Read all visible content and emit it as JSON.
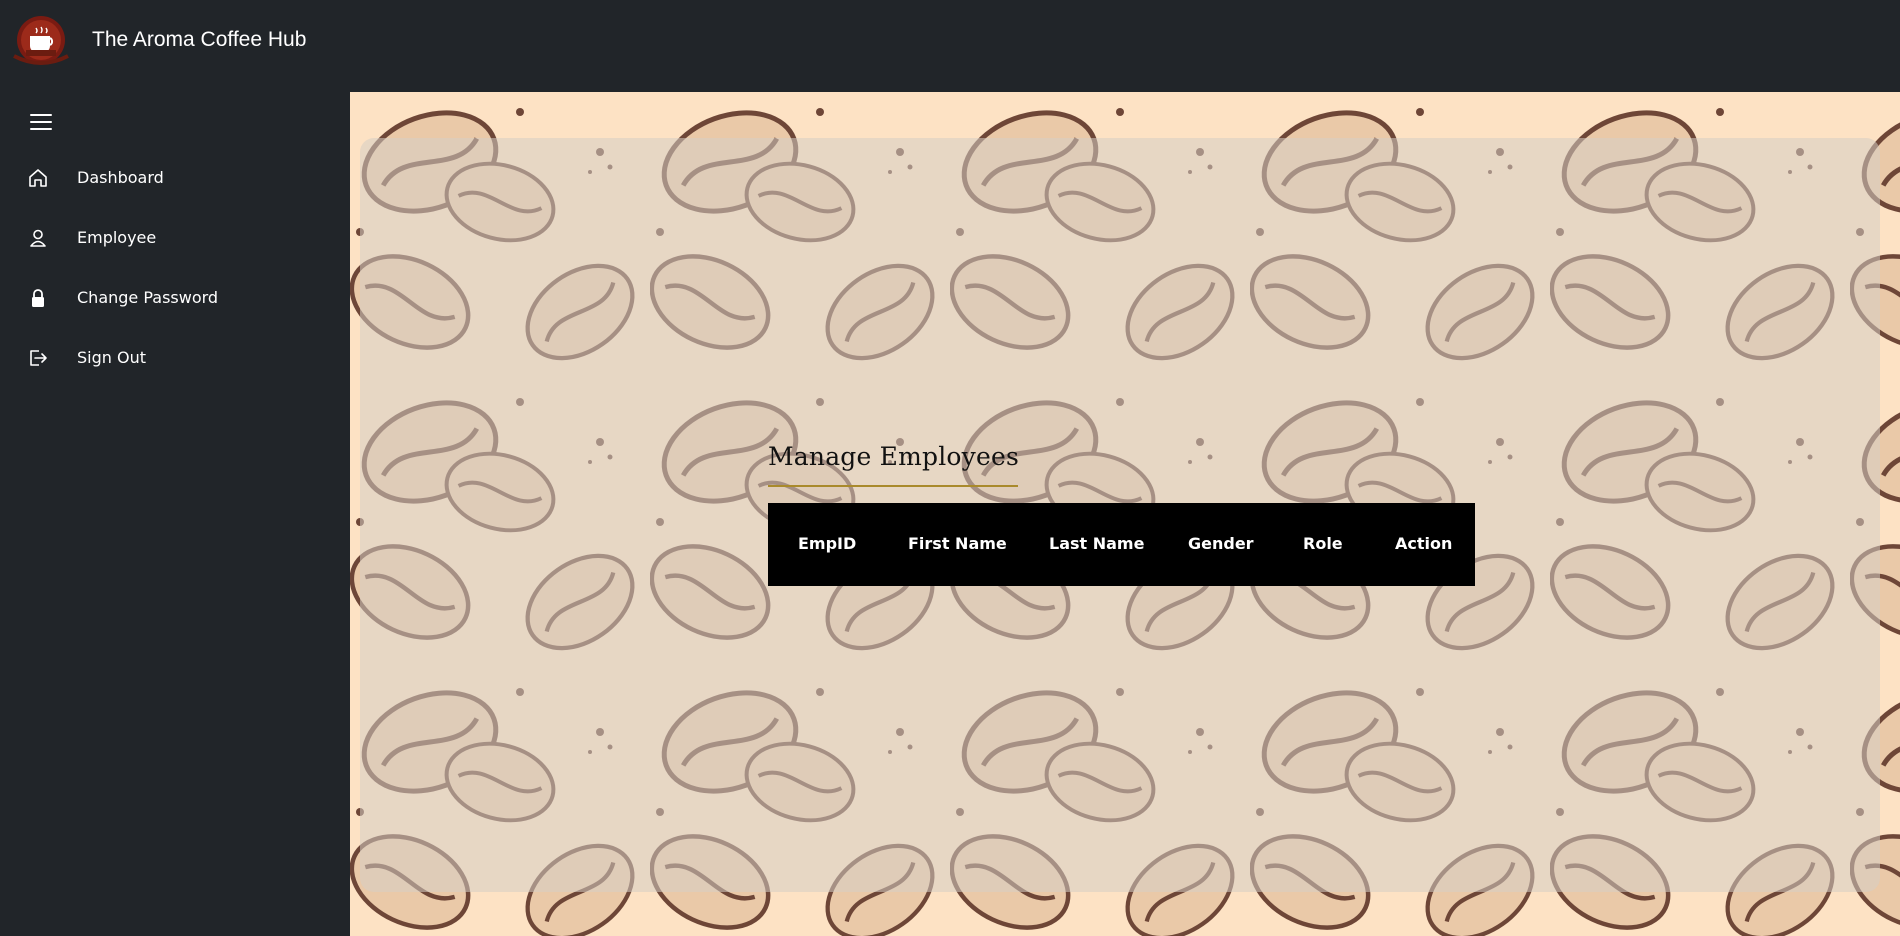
{
  "app": {
    "title": "The Aroma Coffee Hub",
    "logo_icon": "coffee-logo-icon"
  },
  "sidebar": {
    "menu_icon": "hamburger-icon",
    "items": [
      {
        "label": "Dashboard",
        "icon": "home-icon"
      },
      {
        "label": "Employee",
        "icon": "person-icon"
      },
      {
        "label": "Change Password",
        "icon": "lock-icon"
      },
      {
        "label": "Sign Out",
        "icon": "sign-out-icon"
      }
    ]
  },
  "main": {
    "heading": "Manage Employees",
    "table": {
      "columns": [
        "EmpID",
        "First Name",
        "Last Name",
        "Gender",
        "Role",
        "Action"
      ],
      "rows": []
    }
  },
  "colors": {
    "topbar_bg": "#212529",
    "sidebar_bg": "#212529",
    "content_bg": "#fde2c4",
    "table_header_bg": "#000000",
    "heading_underline": "#a98a2c"
  }
}
